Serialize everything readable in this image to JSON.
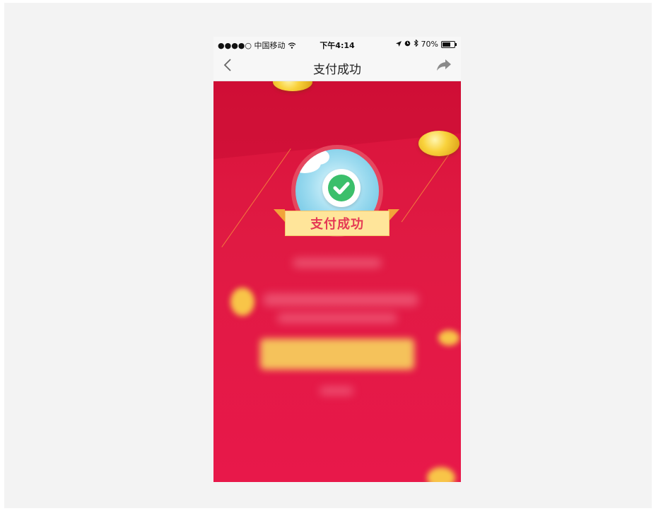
{
  "status_bar": {
    "carrier": "●●●●○ 中国移动",
    "time": "下午4:14",
    "battery_percent": "70%",
    "battery_level": 0.7
  },
  "nav": {
    "title": "支付成功",
    "back_icon": "chevron-left-icon",
    "share_icon": "share-arrow-icon"
  },
  "badge": {
    "ribbon_text": "支付成功",
    "icon": "check-icon"
  },
  "colors": {
    "background_red": "#e0173f",
    "ribbon_yellow": "#ffe59a",
    "ribbon_text": "#e53a55",
    "check_green": "#3bbf6b",
    "coin_gold": "#f9d23c"
  }
}
